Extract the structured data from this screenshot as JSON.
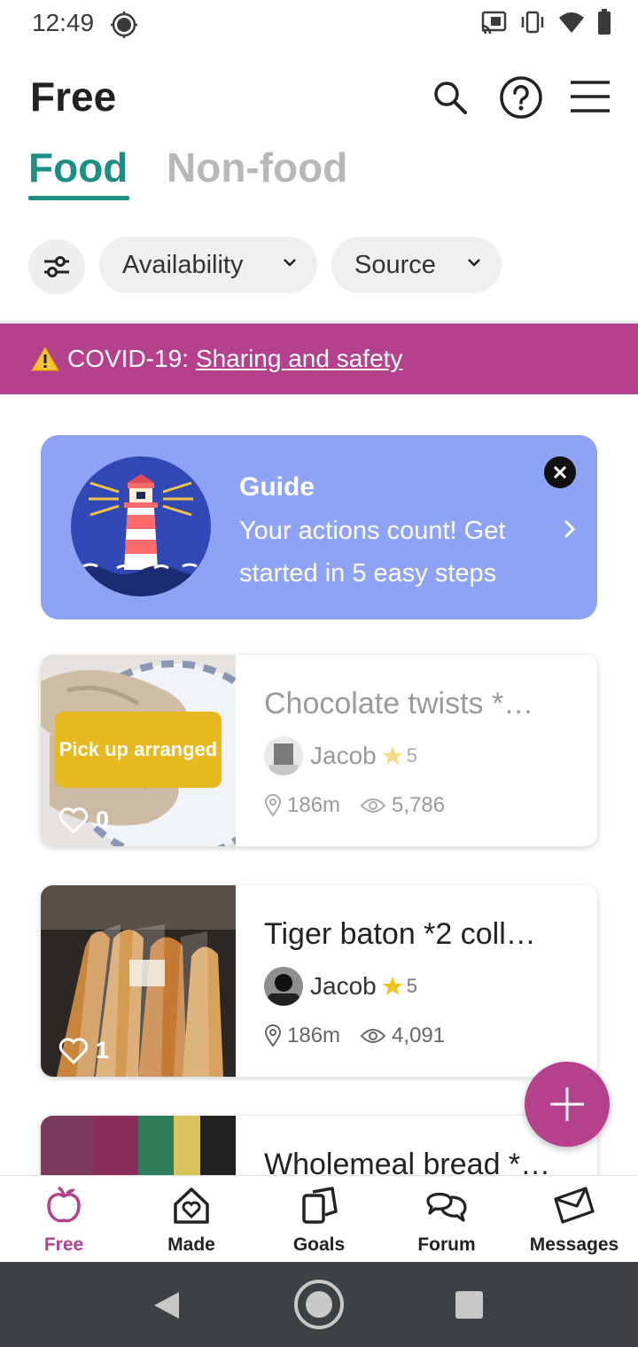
{
  "status_bar": {
    "time": "12:49"
  },
  "header": {
    "title": "Free"
  },
  "tabs": [
    {
      "label": "Food",
      "active": true
    },
    {
      "label": "Non-food",
      "active": false
    }
  ],
  "filters": {
    "chips": [
      {
        "label": "Availability"
      },
      {
        "label": "Source"
      }
    ]
  },
  "covid_banner": {
    "prefix": "COVID-19:",
    "link": "Sharing and safety",
    "color": "#b5418c"
  },
  "guide": {
    "title": "Guide",
    "text": "Your actions count! Get started in 5 easy steps",
    "color": "#8ea3f6"
  },
  "listings": [
    {
      "title": "Chocolate twists *…",
      "badge": "Pick up arranged",
      "likes": "0",
      "user": "Jacob",
      "rating": "5",
      "distance": "186m",
      "views": "5,786",
      "faded": true
    },
    {
      "title": "Tiger baton *2 coll…",
      "likes": "1",
      "user": "Jacob",
      "rating": "5",
      "distance": "186m",
      "views": "4,091",
      "faded": false
    },
    {
      "title": "Wholemeal bread *…"
    }
  ],
  "bottom_nav": [
    {
      "label": "Free",
      "icon": "apple-icon",
      "active": true
    },
    {
      "label": "Made",
      "icon": "house-heart-icon"
    },
    {
      "label": "Goals",
      "icon": "goals-icon"
    },
    {
      "label": "Forum",
      "icon": "chat-bubbles-icon"
    },
    {
      "label": "Messages",
      "icon": "envelope-icon"
    }
  ],
  "colors": {
    "accent_teal": "#1b8f83",
    "brand_magenta": "#b5418c",
    "star": "#f2c31c"
  }
}
